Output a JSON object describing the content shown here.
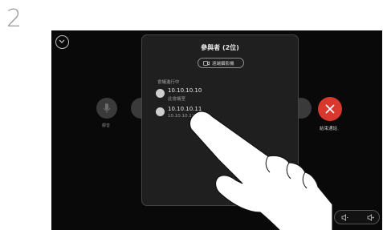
{
  "step_number": "2",
  "panel": {
    "title": "參與者 (2位)",
    "video_button_label": "遠端攝影機",
    "section_label": "會議進行中",
    "participants": [
      {
        "name": "10.10.10.10",
        "detail": "此會議室"
      },
      {
        "name": "10.10.10.11",
        "detail": "10.10.10.11"
      }
    ]
  },
  "call_controls": {
    "mute_label": "靜音",
    "end_call_label": "結束通話"
  },
  "colors": {
    "end_call": "#d8392f",
    "background": "#090909",
    "panel": "#1f1f1f"
  },
  "icons": [
    "chevron-down-icon",
    "microphone-icon",
    "camera-icon",
    "close-icon",
    "volume-down-icon",
    "volume-up-icon",
    "pointing-hand-icon"
  ]
}
